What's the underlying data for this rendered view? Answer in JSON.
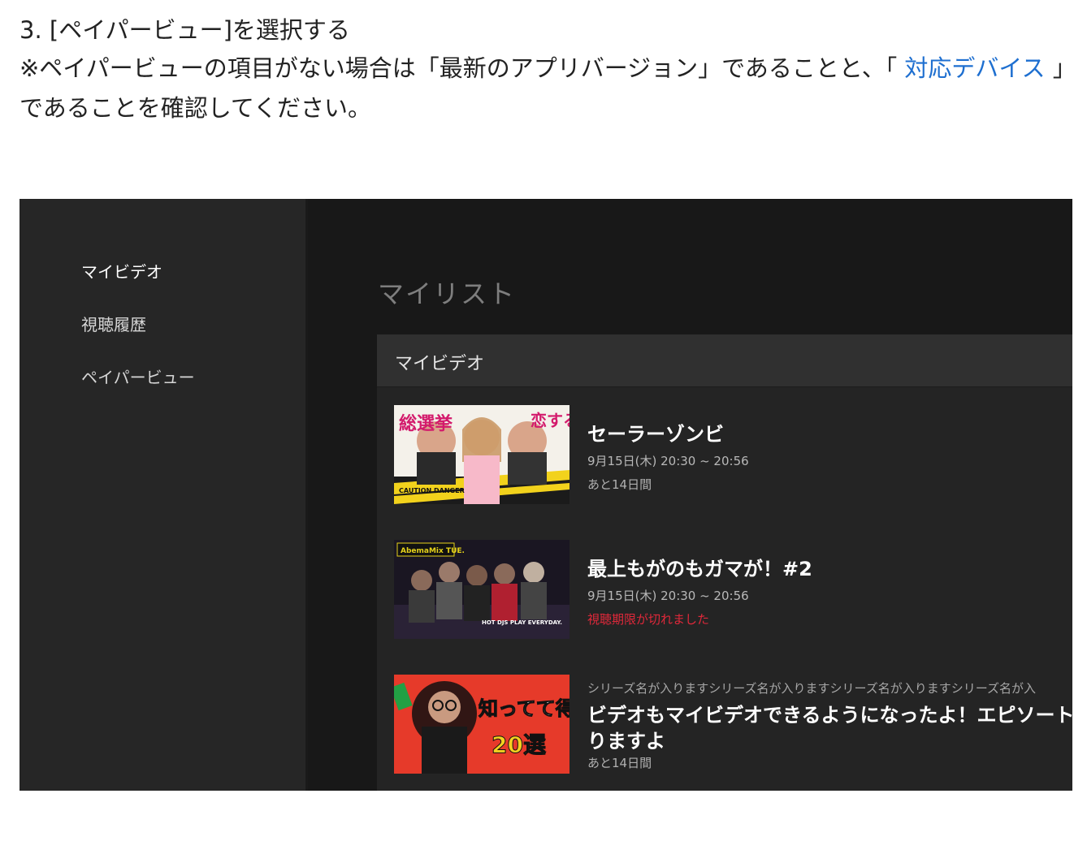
{
  "instructions": {
    "step_title": "3. [ペイパービュー]を選択する",
    "note_before": "※ペイパービューの項目がない場合は「最新のアプリバージョン」であることと、「 ",
    "note_link": "対応デバイス",
    "note_after": " 」であることを確認してください。"
  },
  "sidebar": {
    "items": [
      {
        "label": "マイビデオ"
      },
      {
        "label": "視聴履歴"
      },
      {
        "label": "ペイパービュー"
      }
    ]
  },
  "main": {
    "section_title": "マイリスト",
    "panel_title": "マイビデオ",
    "videos": [
      {
        "title": "セーラーゾンビ",
        "time": "9月15日(木) 20:30 ~ 20:56",
        "status": "あと14日間",
        "thumb_text_a": "恋する",
        "thumb_text_b": "総選挙",
        "thumb_text_c": "CAUTION DANGER"
      },
      {
        "title": "最上もがのもガマが！#2",
        "time": "9月15日(木) 20:30 ~ 20:56",
        "status": "視聴期限が切れました",
        "thumb_text_a": "AbemaMix TUE.",
        "thumb_text_b": "HOT DJS PLAY EVERYDAY."
      },
      {
        "series": "シリーズ名が入りますシリーズ名が入りますシリーズ名が入りますシリーズ名が入",
        "title_line1": "ビデオもマイビデオできるようになったよ！エピソート",
        "title_line2": "りますよ",
        "status": "あと14日間",
        "thumb_text_a": "知ってて得",
        "thumb_text_b": "20選"
      }
    ]
  },
  "colors": {
    "link": "#1e6fd0",
    "expired": "#e0283a",
    "sidebar_bg": "#262626",
    "main_bg": "#181818"
  }
}
